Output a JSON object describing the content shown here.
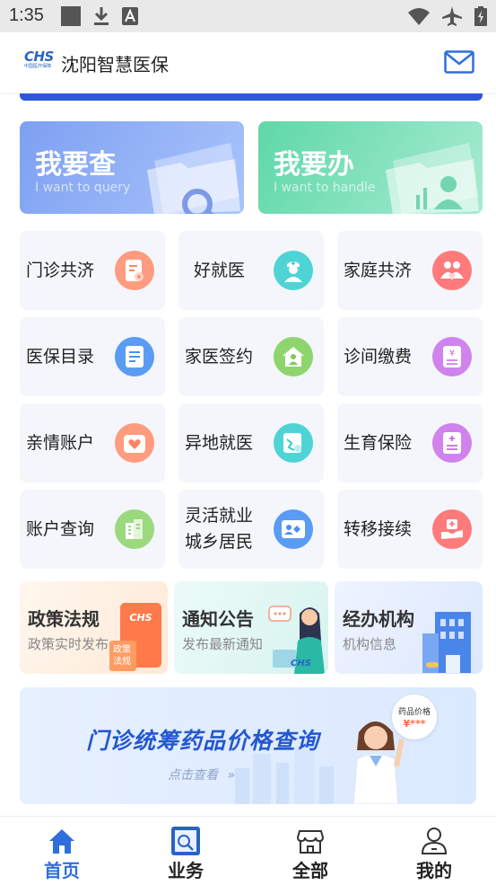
{
  "status_bar": {
    "time": "1:35"
  },
  "header": {
    "logo_text": "CHS",
    "logo_sub": "中国医疗保障",
    "title": "沈阳智慧医保"
  },
  "big_buttons": [
    {
      "title": "我要查",
      "subtitle": "I want to query",
      "color": "#7ea0f2"
    },
    {
      "title": "我要办",
      "subtitle": "I want to handle",
      "color": "#5fd7a9"
    }
  ],
  "grid": [
    {
      "label": "门诊共济",
      "icon": "prescription-icon",
      "color": "#ff8466"
    },
    {
      "label": "好就医",
      "icon": "doctor-icon",
      "color": "#33cbd0"
    },
    {
      "label": "家庭共济",
      "icon": "family-icon",
      "color": "#ff6a6a"
    },
    {
      "label": "医保目录",
      "icon": "catalog-icon",
      "color": "#4a8ff0"
    },
    {
      "label": "家医签约",
      "icon": "home-doctor-icon",
      "color": "#7ccb5c"
    },
    {
      "label": "诊间缴费",
      "icon": "payment-icon",
      "color": "#c569e8"
    },
    {
      "label": "亲情账户",
      "icon": "heart-account-icon",
      "color": "#ff8466"
    },
    {
      "label": "异地就医",
      "icon": "remote-medical-icon",
      "color": "#33cbd0"
    },
    {
      "label": "生育保险",
      "icon": "maternity-icon",
      "color": "#c569e8"
    },
    {
      "label": "账户查询",
      "icon": "account-query-icon",
      "color": "#7ccb5c"
    },
    {
      "label_lines": [
        "灵活就业",
        "城乡居民"
      ],
      "icon": "resident-card-icon",
      "color": "#4a8ff0"
    },
    {
      "label": "转移接续",
      "icon": "transfer-icon",
      "color": "#ff6a6a"
    }
  ],
  "cards": [
    {
      "title": "政策法规",
      "subtitle": "政策实时发布",
      "badge": "政策\n法规"
    },
    {
      "title": "通知公告",
      "subtitle": "发布最新通知",
      "badge": "CHS"
    },
    {
      "title": "经办机构",
      "subtitle": "机构信息"
    }
  ],
  "banner": {
    "title": "门诊统筹药品价格查询",
    "subtitle": "点击查看",
    "bubble_title": "药品价格",
    "bubble_value": "¥***"
  },
  "bottom_nav": [
    {
      "label": "首页",
      "icon": "home-icon",
      "active": true
    },
    {
      "label": "业务",
      "icon": "business-icon",
      "active": false
    },
    {
      "label": "全部",
      "icon": "store-icon",
      "active": false
    },
    {
      "label": "我的",
      "icon": "user-icon",
      "active": false
    }
  ],
  "colors": {
    "accent": "#2f6fdc",
    "brand": "#2b63c4"
  }
}
